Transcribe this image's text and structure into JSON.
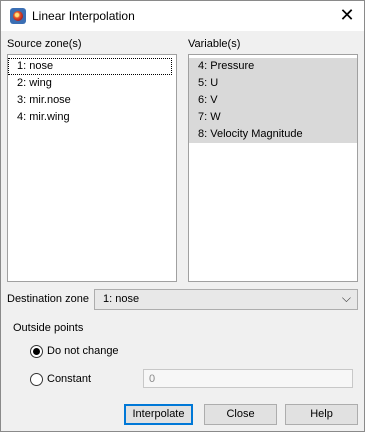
{
  "window": {
    "title": "Linear Interpolation",
    "close_glyph": "✕"
  },
  "source_zones": {
    "label": "Source zone(s)",
    "items": [
      "1: nose",
      "2: wing",
      "3: mir.nose",
      "4: mir.wing"
    ],
    "focused_index": 0
  },
  "variables": {
    "label": "Variable(s)",
    "items": [
      "4: Pressure",
      "5: U",
      "6: V",
      "7: W",
      "8: Velocity Magnitude"
    ],
    "all_selected": true
  },
  "destination": {
    "label": "Destination zone",
    "value": "1: nose",
    "chevron": "⌵"
  },
  "outside_points": {
    "label": "Outside points",
    "options": [
      {
        "label": "Do not change",
        "checked": true
      },
      {
        "label": "Constant",
        "checked": false
      }
    ],
    "constant_value": "0"
  },
  "buttons": {
    "interpolate": "Interpolate",
    "close": "Close",
    "help": "Help"
  },
  "colors": {
    "selection": "#d9d9d9",
    "default_button_border": "#0078d7",
    "dialog_bg": "#f0f0f0"
  },
  "icons": {
    "app": "tecplot-app-icon",
    "close": "close-icon",
    "dropdown": "chevron-down-icon"
  }
}
